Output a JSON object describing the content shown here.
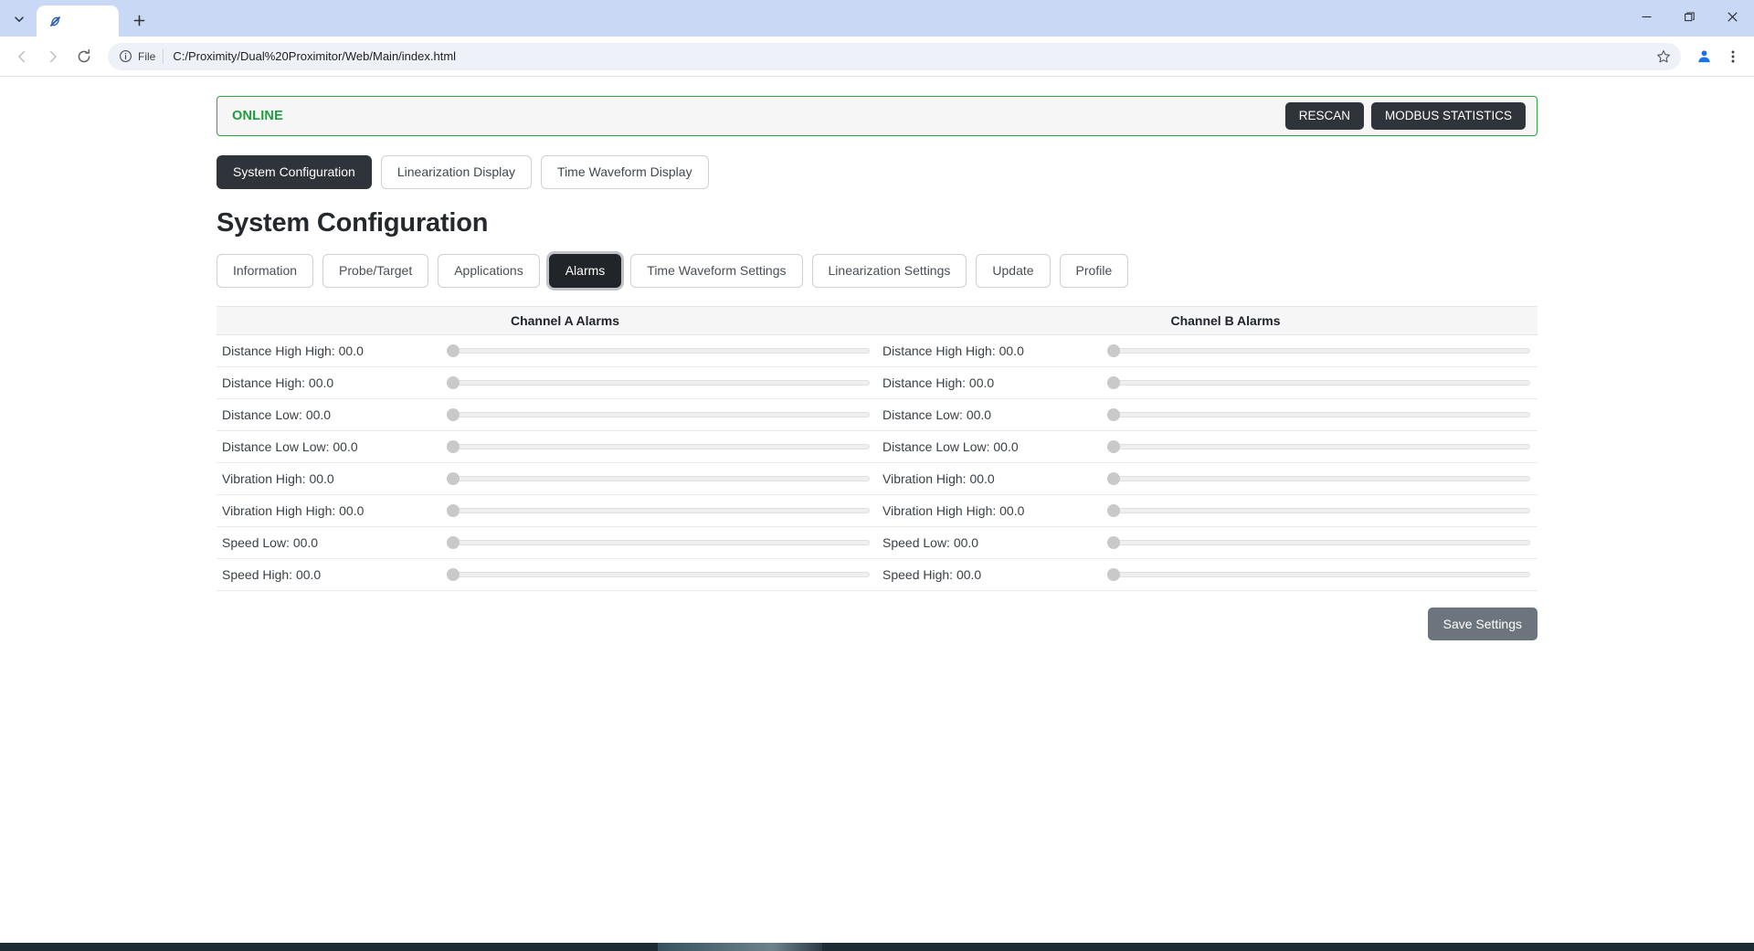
{
  "browser": {
    "tab": {
      "title": "",
      "favicon_icon": "proximitor-logo-icon"
    },
    "tab_list_icon": "chevron-down-icon",
    "new_tab_icon": "plus-icon",
    "window_controls": {
      "minimize": "minimize-icon",
      "maximize": "maximize-icon",
      "close": "close-icon"
    },
    "nav": {
      "back_icon": "arrow-left-icon",
      "forward_icon": "arrow-right-icon",
      "reload_icon": "reload-icon"
    },
    "omnibox": {
      "info_icon": "info-circle-icon",
      "scheme_label": "File",
      "url": "C:/Proximity/Dual%20Proximitor/Web/Main/index.html",
      "placeholder": "Search or type URL",
      "star_icon": "star-icon"
    },
    "profile_icon": "account-avatar-icon",
    "menu_icon": "three-dot-menu-icon"
  },
  "status": {
    "label": "ONLINE",
    "color": "#1a9e3f",
    "border_color": "#28a745",
    "rescan_label": "RESCAN",
    "modbus_label": "MODBUS STATISTICS"
  },
  "main_nav": {
    "items": [
      {
        "label": "System Configuration",
        "active": true
      },
      {
        "label": "Linearization Display",
        "active": false
      },
      {
        "label": "Time Waveform Display",
        "active": false
      }
    ]
  },
  "page_title": "System Configuration",
  "sub_tabs": {
    "items": [
      {
        "label": "Information",
        "active": false
      },
      {
        "label": "Probe/Target",
        "active": false
      },
      {
        "label": "Applications",
        "active": false
      },
      {
        "label": "Alarms",
        "active": true
      },
      {
        "label": "Time Waveform Settings",
        "active": false
      },
      {
        "label": "Linearization Settings",
        "active": false
      },
      {
        "label": "Update",
        "active": false
      },
      {
        "label": "Profile",
        "active": false
      }
    ]
  },
  "alarms": {
    "columns": [
      {
        "header": "Channel A Alarms"
      },
      {
        "header": "Channel B Alarms"
      }
    ],
    "rows": [
      {
        "a_label": "Distance High High: 00.0",
        "a_value": 0,
        "b_label": "Distance High High: 00.0",
        "b_value": 0
      },
      {
        "a_label": "Distance High: 00.0",
        "a_value": 0,
        "b_label": "Distance High: 00.0",
        "b_value": 0
      },
      {
        "a_label": "Distance Low: 00.0",
        "a_value": 0,
        "b_label": "Distance Low: 00.0",
        "b_value": 0
      },
      {
        "a_label": "Distance Low Low: 00.0",
        "a_value": 0,
        "b_label": "Distance Low Low: 00.0",
        "b_value": 0
      },
      {
        "a_label": "Vibration High: 00.0",
        "a_value": 0,
        "b_label": "Vibration High: 00.0",
        "b_value": 0
      },
      {
        "a_label": "Vibration High High: 00.0",
        "a_value": 0,
        "b_label": "Vibration High High: 00.0",
        "b_value": 0
      },
      {
        "a_label": "Speed Low: 00.0",
        "a_value": 0,
        "b_label": "Speed Low: 00.0",
        "b_value": 0
      },
      {
        "a_label": "Speed High: 00.0",
        "a_value": 0,
        "b_label": "Speed High: 00.0",
        "b_value": 0
      }
    ],
    "save_label": "Save Settings"
  }
}
